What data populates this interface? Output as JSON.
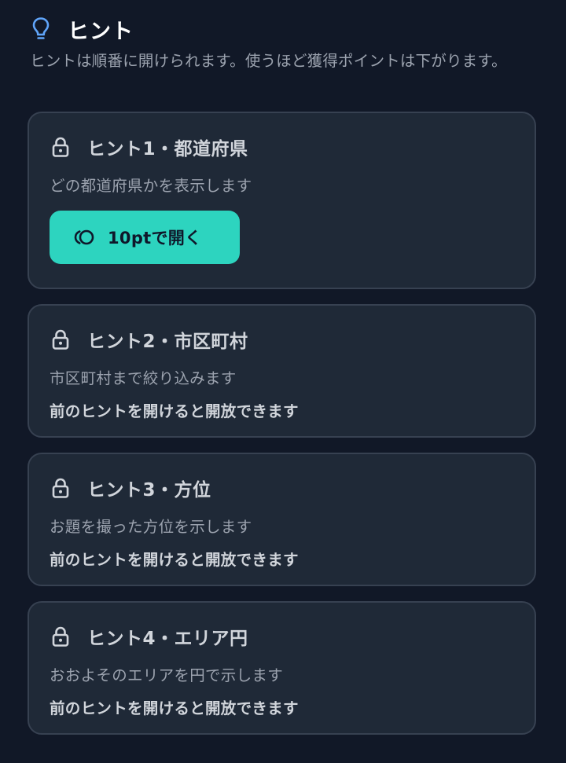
{
  "header": {
    "title": "ヒント",
    "icon": "lightbulb-icon",
    "icon_color": "#60a5fa"
  },
  "intro": "ヒントは順番に開けられます。使うほど獲得ポイントは下がります。",
  "colors": {
    "background": "#111827",
    "card": "#1f2937",
    "card_border": "#374151",
    "accent": "#2dd4bf"
  },
  "hints": [
    {
      "title": "ヒント1・都道府県",
      "description": "どの都道府県かを表示します",
      "button_label": "10ptで開く",
      "button_icon": "coin-icon"
    },
    {
      "title": "ヒント2・市区町村",
      "description": "市区町村まで絞り込みます",
      "note": "前のヒントを開けると開放できます"
    },
    {
      "title": "ヒント3・方位",
      "description": "お題を撮った方位を示します",
      "note": "前のヒントを開けると開放できます"
    },
    {
      "title": "ヒント4・エリア円",
      "description": "おおよそのエリアを円で示します",
      "note": "前のヒントを開けると開放できます"
    }
  ]
}
